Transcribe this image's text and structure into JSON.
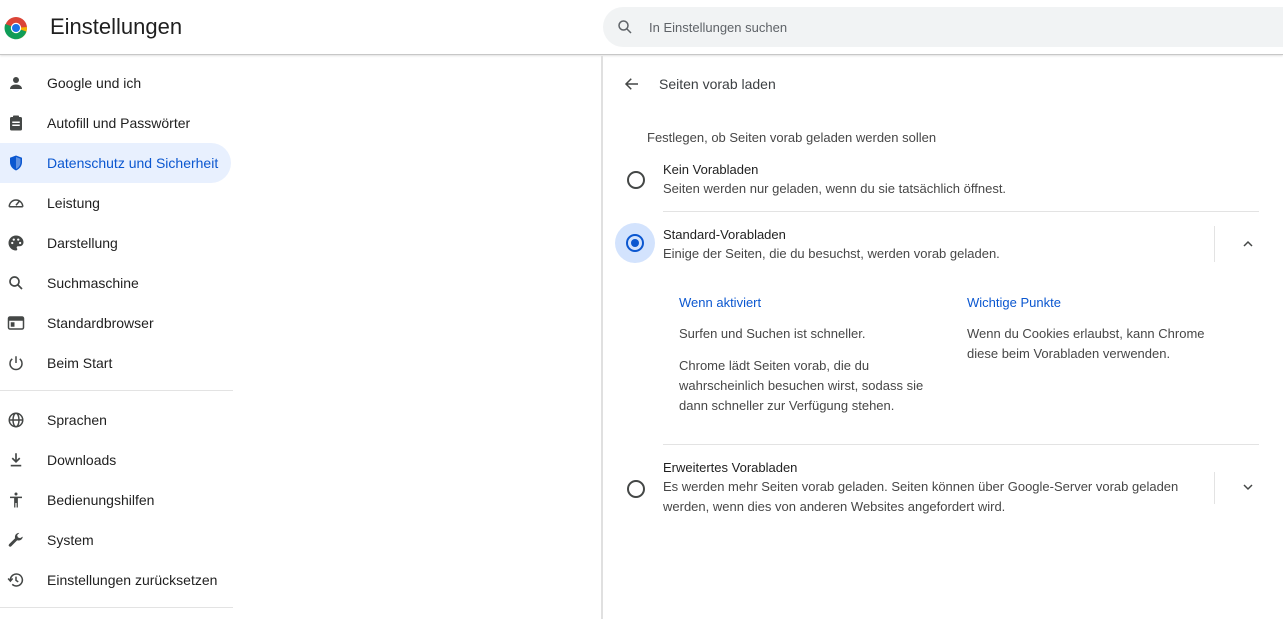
{
  "header": {
    "title": "Einstellungen",
    "search_placeholder": "In Einstellungen suchen"
  },
  "sidebar": {
    "items": [
      {
        "label": "Google und ich",
        "icon": "person-icon"
      },
      {
        "label": "Autofill und Passwörter",
        "icon": "clipboard-icon"
      },
      {
        "label": "Datenschutz und Sicherheit",
        "icon": "shield-icon",
        "active": true
      },
      {
        "label": "Leistung",
        "icon": "speedometer-icon"
      },
      {
        "label": "Darstellung",
        "icon": "palette-icon"
      },
      {
        "label": "Suchmaschine",
        "icon": "search-icon"
      },
      {
        "label": "Standardbrowser",
        "icon": "browser-icon"
      },
      {
        "label": "Beim Start",
        "icon": "power-icon"
      },
      {
        "label": "Sprachen",
        "icon": "globe-icon"
      },
      {
        "label": "Downloads",
        "icon": "download-icon"
      },
      {
        "label": "Bedienungshilfen",
        "icon": "accessibility-icon"
      },
      {
        "label": "System",
        "icon": "wrench-icon"
      },
      {
        "label": "Einstellungen zurücksetzen",
        "icon": "history-icon"
      }
    ]
  },
  "main": {
    "page_title": "Seiten vorab laden",
    "section_desc": "Festlegen, ob Seiten vorab geladen werden sollen",
    "options": [
      {
        "title": "Kein Vorabladen",
        "sub": "Seiten werden nur geladen, wenn du sie tatsächlich öffnest.",
        "checked": false
      },
      {
        "title": "Standard-Vorabladen",
        "sub": "Einige der Seiten, die du besuchst, werden vorab geladen.",
        "checked": true,
        "expanded": true
      },
      {
        "title": "Erweitertes Vorabladen",
        "sub_line1": "Es werden mehr Seiten vorab geladen. Seiten können über Google-Server vorab geladen",
        "sub_line2": "werden, wenn dies von anderen Websites angefordert wird.",
        "checked": false,
        "expanded": false
      }
    ],
    "details": {
      "left_head": "Wenn aktiviert",
      "left_p1": "Surfen und Suchen ist schneller.",
      "left_p2": "Chrome lädt Seiten vorab, die du wahrscheinlich besuchen wirst, sodass sie dann schneller zur Verfügung stehen.",
      "right_head": "Wichtige Punkte",
      "right_p1": "Wenn du Cookies erlaubst, kann Chrome diese beim Vorabladen verwenden."
    }
  },
  "colors": {
    "accent": "#0b57d0",
    "active_bg": "#e8f0fe",
    "radio_halo": "#d3e3fd"
  }
}
